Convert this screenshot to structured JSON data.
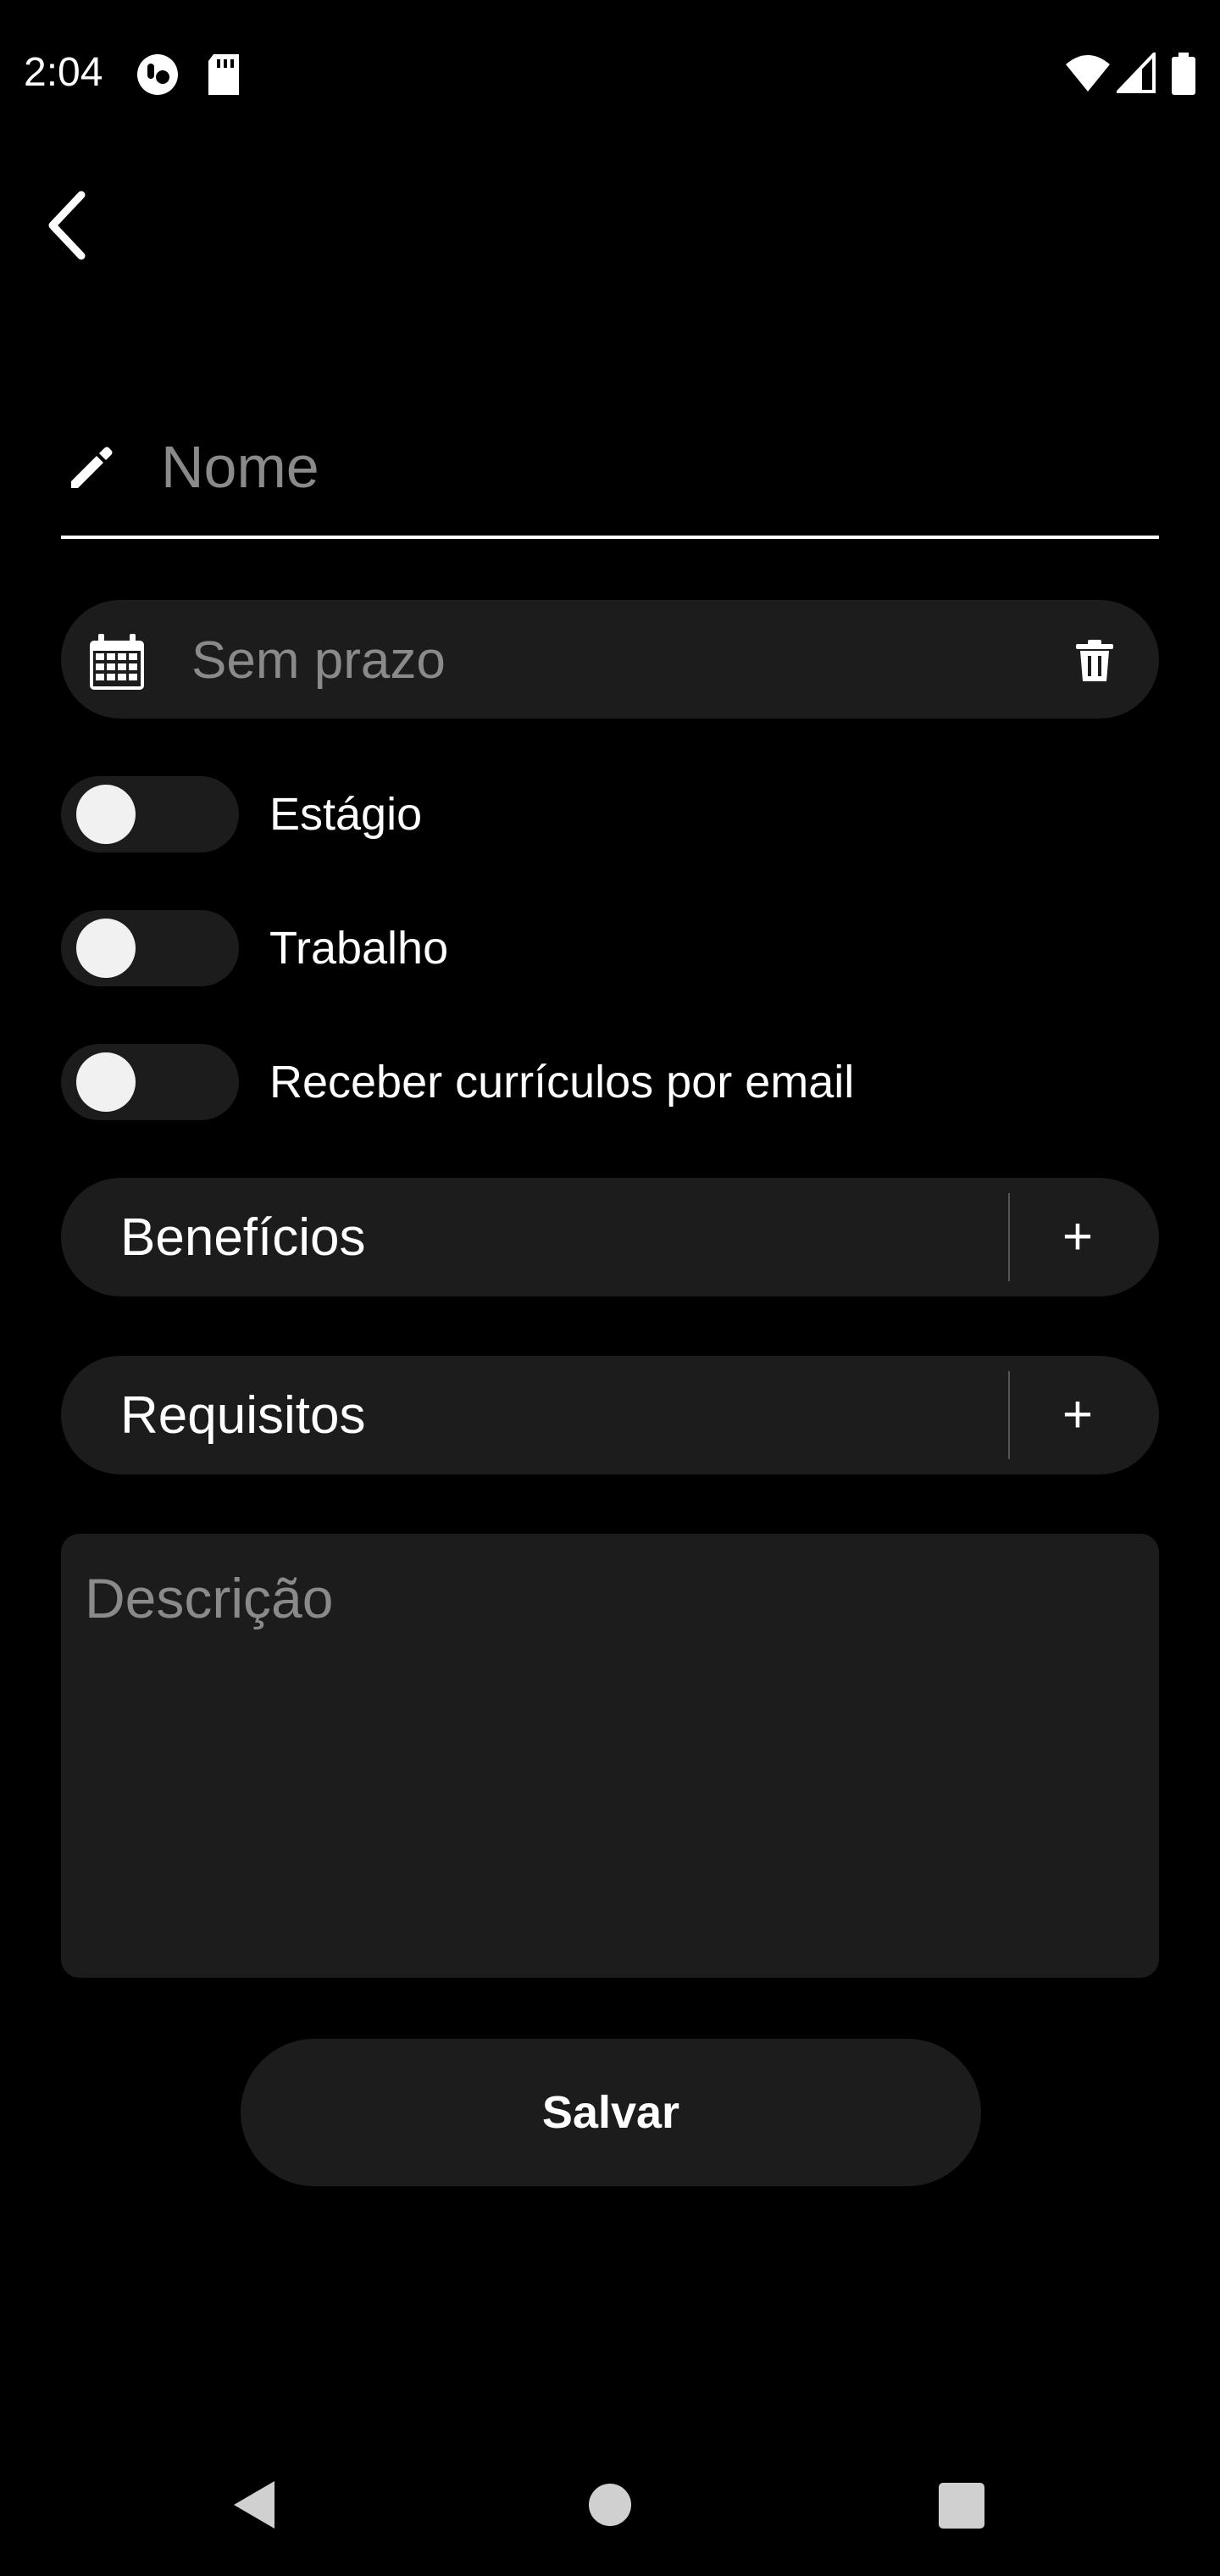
{
  "status_bar": {
    "time": "2:04"
  },
  "form": {
    "name_placeholder": "Nome",
    "deadline_text": "Sem prazo",
    "toggles": [
      {
        "label": "Estágio",
        "checked": false
      },
      {
        "label": "Trabalho",
        "checked": false
      },
      {
        "label": "Receber currículos por email",
        "checked": false
      }
    ],
    "benefits_label": "Benefícios",
    "requirements_label": "Requisitos",
    "add_symbol": "+",
    "description_placeholder": "Descrição",
    "save_label": "Salvar"
  },
  "icons": {
    "back": "back-arrow-icon",
    "edit": "pencil-icon",
    "calendar": "calendar-icon",
    "delete": "trash-icon"
  },
  "colors": {
    "background": "#000000",
    "surface": "#1c1c1c",
    "placeholder": "#8a8a8a",
    "text": "#ffffff"
  }
}
